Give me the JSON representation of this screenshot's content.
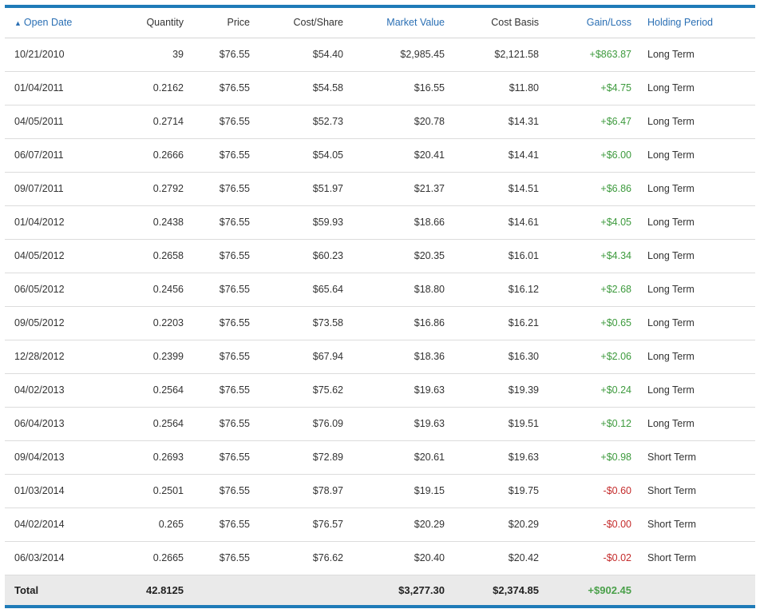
{
  "colors": {
    "accent": "#1f7bb8",
    "link": "#2a6fb4",
    "gain": "#3d9a3d",
    "loss": "#c42b2b"
  },
  "header": {
    "sort_icon": "sort-ascending-icon",
    "open_date": "Open Date",
    "quantity": "Quantity",
    "price": "Price",
    "cost_share": "Cost/Share",
    "market_value": "Market Value",
    "cost_basis": "Cost Basis",
    "gain_loss": "Gain/Loss",
    "holding_period": "Holding Period"
  },
  "rows": [
    {
      "date": "10/21/2010",
      "qty": "39",
      "price": "$76.55",
      "cps": "$54.40",
      "mv": "$2,985.45",
      "cb": "$2,121.58",
      "gl": "+$863.87",
      "hp": "Long Term"
    },
    {
      "date": "01/04/2011",
      "qty": "0.2162",
      "price": "$76.55",
      "cps": "$54.58",
      "mv": "$16.55",
      "cb": "$11.80",
      "gl": "+$4.75",
      "hp": "Long Term"
    },
    {
      "date": "04/05/2011",
      "qty": "0.2714",
      "price": "$76.55",
      "cps": "$52.73",
      "mv": "$20.78",
      "cb": "$14.31",
      "gl": "+$6.47",
      "hp": "Long Term"
    },
    {
      "date": "06/07/2011",
      "qty": "0.2666",
      "price": "$76.55",
      "cps": "$54.05",
      "mv": "$20.41",
      "cb": "$14.41",
      "gl": "+$6.00",
      "hp": "Long Term"
    },
    {
      "date": "09/07/2011",
      "qty": "0.2792",
      "price": "$76.55",
      "cps": "$51.97",
      "mv": "$21.37",
      "cb": "$14.51",
      "gl": "+$6.86",
      "hp": "Long Term"
    },
    {
      "date": "01/04/2012",
      "qty": "0.2438",
      "price": "$76.55",
      "cps": "$59.93",
      "mv": "$18.66",
      "cb": "$14.61",
      "gl": "+$4.05",
      "hp": "Long Term"
    },
    {
      "date": "04/05/2012",
      "qty": "0.2658",
      "price": "$76.55",
      "cps": "$60.23",
      "mv": "$20.35",
      "cb": "$16.01",
      "gl": "+$4.34",
      "hp": "Long Term"
    },
    {
      "date": "06/05/2012",
      "qty": "0.2456",
      "price": "$76.55",
      "cps": "$65.64",
      "mv": "$18.80",
      "cb": "$16.12",
      "gl": "+$2.68",
      "hp": "Long Term"
    },
    {
      "date": "09/05/2012",
      "qty": "0.2203",
      "price": "$76.55",
      "cps": "$73.58",
      "mv": "$16.86",
      "cb": "$16.21",
      "gl": "+$0.65",
      "hp": "Long Term"
    },
    {
      "date": "12/28/2012",
      "qty": "0.2399",
      "price": "$76.55",
      "cps": "$67.94",
      "mv": "$18.36",
      "cb": "$16.30",
      "gl": "+$2.06",
      "hp": "Long Term"
    },
    {
      "date": "04/02/2013",
      "qty": "0.2564",
      "price": "$76.55",
      "cps": "$75.62",
      "mv": "$19.63",
      "cb": "$19.39",
      "gl": "+$0.24",
      "hp": "Long Term"
    },
    {
      "date": "06/04/2013",
      "qty": "0.2564",
      "price": "$76.55",
      "cps": "$76.09",
      "mv": "$19.63",
      "cb": "$19.51",
      "gl": "+$0.12",
      "hp": "Long Term"
    },
    {
      "date": "09/04/2013",
      "qty": "0.2693",
      "price": "$76.55",
      "cps": "$72.89",
      "mv": "$20.61",
      "cb": "$19.63",
      "gl": "+$0.98",
      "hp": "Short Term"
    },
    {
      "date": "01/03/2014",
      "qty": "0.2501",
      "price": "$76.55",
      "cps": "$78.97",
      "mv": "$19.15",
      "cb": "$19.75",
      "gl": "-$0.60",
      "hp": "Short Term"
    },
    {
      "date": "04/02/2014",
      "qty": "0.265",
      "price": "$76.55",
      "cps": "$76.57",
      "mv": "$20.29",
      "cb": "$20.29",
      "gl": "-$0.00",
      "hp": "Short Term"
    },
    {
      "date": "06/03/2014",
      "qty": "0.2665",
      "price": "$76.55",
      "cps": "$76.62",
      "mv": "$20.40",
      "cb": "$20.42",
      "gl": "-$0.02",
      "hp": "Short Term"
    }
  ],
  "total": {
    "label": "Total",
    "qty": "42.8125",
    "mv": "$3,277.30",
    "cb": "$2,374.85",
    "gl": "+$902.45"
  }
}
